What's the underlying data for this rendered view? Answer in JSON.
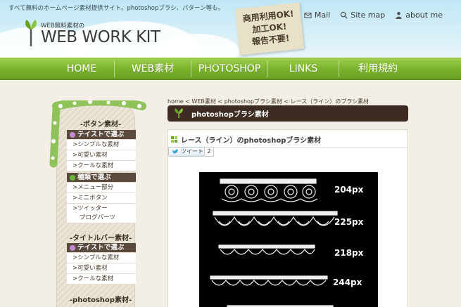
{
  "header": {
    "tagline": "すべて無料のホームページ素材提供サイト。photoshopブラシ、パターン等も。",
    "logo_sub": "WEB無料素材の",
    "logo_main": "WEB WORK KIT",
    "note_lines": [
      "商用利用OK!",
      "加工OK!",
      "報告不要!"
    ],
    "top_links": [
      {
        "label": "Mail",
        "icon": "mail-icon"
      },
      {
        "label": "Site map",
        "icon": "search-icon"
      },
      {
        "label": "about me",
        "icon": "person-icon"
      }
    ]
  },
  "nav": {
    "items": [
      "HOME",
      "WEB素材",
      "PHOTOSHOP",
      "LINKS",
      "利用規約"
    ]
  },
  "sidebar": {
    "sections": [
      {
        "title": "-ボタン素材-",
        "groups": [
          {
            "head": "テイストで選ぶ",
            "links": [
              ">シンプルな素材",
              ">可愛い素材",
              ">クールな素材"
            ]
          },
          {
            "head": "種類で選ぶ",
            "links": [
              ">メニュー部分",
              ">ミニボタン",
              ">ツイッター",
              "ブログパーツ"
            ]
          }
        ]
      },
      {
        "title": "-タイトルバー素材-",
        "groups": [
          {
            "head": "テイストで選ぶ",
            "links": [
              ">シンプルな素材",
              ">可愛い素材",
              ">クールな素材"
            ]
          }
        ]
      },
      {
        "title": "-photoshop素材-",
        "groups": []
      }
    ]
  },
  "main": {
    "breadcrumb": "home < WEB素材 < photoshopブラシ素材 < レース（ライン）のブラシ素材",
    "section_title": "photoshopブラシ素材",
    "content_title": "レース（ライン）のphotoshopブラシ素材",
    "tweet_label": "ツイート",
    "tweet_count": "2",
    "previews": [
      "204px",
      "225px",
      "218px",
      "244px"
    ]
  },
  "colors": {
    "nav_green": "#7ab22d",
    "title_bar": "#3c2c22",
    "sky": "#bfe6f5"
  }
}
